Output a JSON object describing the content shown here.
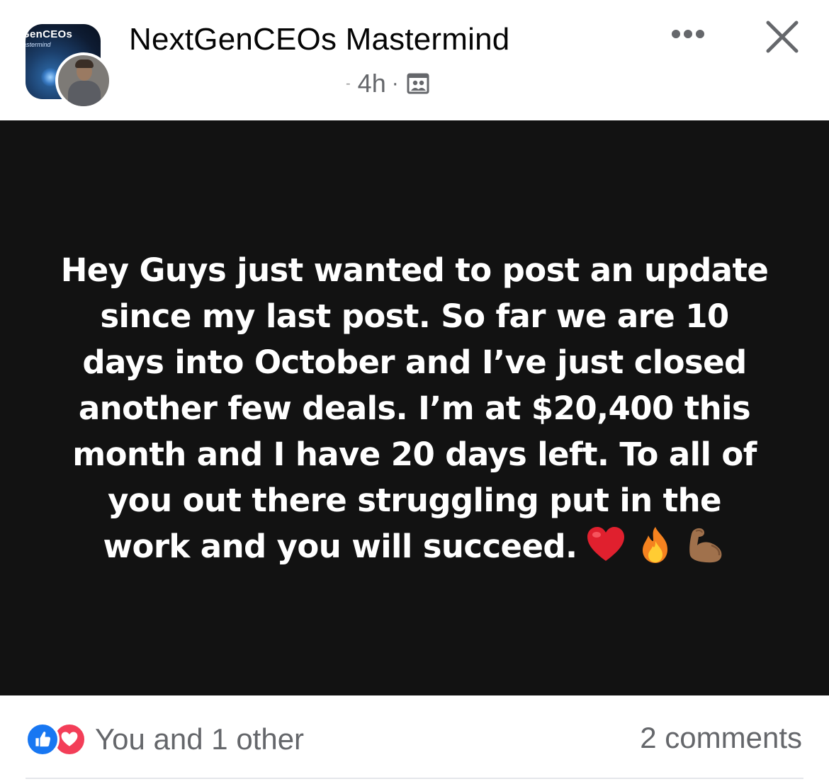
{
  "header": {
    "group_name": "NextGenCEOs Mastermind",
    "group_logo_text": "GenCEOs",
    "group_logo_subtext": "astermind",
    "separator_dash": "-",
    "time": "4h",
    "dot": "·",
    "privacy_icon": "group-privacy-icon",
    "more_icon": "more-options-icon",
    "close_icon": "close-icon"
  },
  "post": {
    "background_color": "#121212",
    "text": "Hey Guys just wanted to post an update since my last post. So far we are 10 days into October and I’ve just closed another few deals. I’m at $20,400 this month and I have 20 days left. To all of you out there struggling put in the work and you will succeed.",
    "emojis": [
      "red-heart-emoji",
      "fire-emoji",
      "flexed-biceps-emoji"
    ]
  },
  "footer": {
    "reaction_icons": [
      "like-reaction-icon",
      "love-reaction-icon"
    ],
    "reactions_text": "You and 1 other",
    "comments_text": "2 comments"
  },
  "colors": {
    "like_blue": "#1877f2",
    "love_red": "#f33e58",
    "secondary_text": "#65676b"
  }
}
